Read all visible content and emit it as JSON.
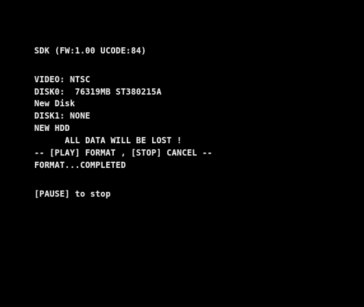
{
  "console": {
    "header": "SDK (FW:1.00 UCODE:84)",
    "video": "VIDEO: NTSC",
    "disk0": "DISK0:  76319MB ST380215A",
    "new_disk": "New Disk",
    "disk1": "DISK1: NONE",
    "new_hdd": "NEW HDD",
    "warning": "      ALL DATA WILL BE LOST !",
    "prompt": "-- [PLAY] FORMAT , [STOP] CANCEL --",
    "format_status": "FORMAT...COMPLETED",
    "pause_hint": "[PAUSE] to stop"
  },
  "colors": {
    "background": "#000000",
    "text": "#e9e9e9"
  }
}
